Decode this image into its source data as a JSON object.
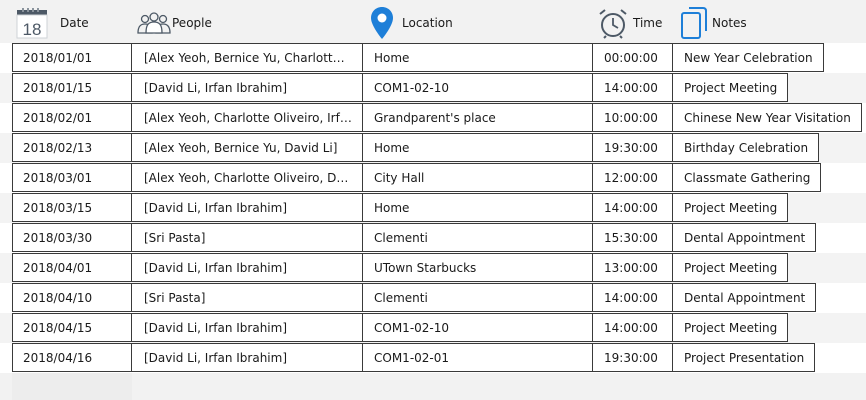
{
  "header": {
    "date_label": "Date",
    "date_icon_day": "18",
    "people_label": "People",
    "location_label": "Location",
    "time_label": "Time",
    "notes_label": "Notes"
  },
  "colors": {
    "accent_blue": "#1e7fd8",
    "calendar_gray": "#4d5966"
  },
  "rows": [
    {
      "date": "2018/01/01",
      "people": "[Alex Yeoh, Bernice Yu, Charlotte Oliveiro, David Li]",
      "location": "Home",
      "time": "00:00:00",
      "notes": "New Year Celebration"
    },
    {
      "date": "2018/01/15",
      "people": "[David Li, Irfan Ibrahim]",
      "location": "COM1-02-10",
      "time": "14:00:00",
      "notes": "Project Meeting"
    },
    {
      "date": "2018/02/01",
      "people": "[Alex Yeoh, Charlotte Oliveiro, Irfan Ibrahim]",
      "location": "Grandparent's place",
      "time": "10:00:00",
      "notes": "Chinese New Year Visitation"
    },
    {
      "date": "2018/02/13",
      "people": "[Alex Yeoh, Bernice Yu, David Li]",
      "location": "Home",
      "time": "19:30:00",
      "notes": "Birthday Celebration"
    },
    {
      "date": "2018/03/01",
      "people": "[Alex Yeoh, Charlotte Oliveiro, David Li]",
      "location": "City Hall",
      "time": "12:00:00",
      "notes": "Classmate Gathering"
    },
    {
      "date": "2018/03/15",
      "people": "[David Li, Irfan Ibrahim]",
      "location": "Home",
      "time": "14:00:00",
      "notes": "Project Meeting"
    },
    {
      "date": "2018/03/30",
      "people": "[Sri Pasta]",
      "location": "Clementi",
      "time": "15:30:00",
      "notes": "Dental Appointment"
    },
    {
      "date": "2018/04/01",
      "people": "[David Li, Irfan Ibrahim]",
      "location": "UTown Starbucks",
      "time": "13:00:00",
      "notes": "Project Meeting"
    },
    {
      "date": "2018/04/10",
      "people": "[Sri Pasta]",
      "location": "Clementi",
      "time": "14:00:00",
      "notes": "Dental Appointment"
    },
    {
      "date": "2018/04/15",
      "people": "[David Li, Irfan Ibrahim]",
      "location": "COM1-02-10",
      "time": "14:00:00",
      "notes": "Project Meeting"
    },
    {
      "date": "2018/04/16",
      "people": "[David Li, Irfan Ibrahim]",
      "location": "COM1-02-01",
      "time": "19:30:00",
      "notes": "Project Presentation"
    }
  ]
}
